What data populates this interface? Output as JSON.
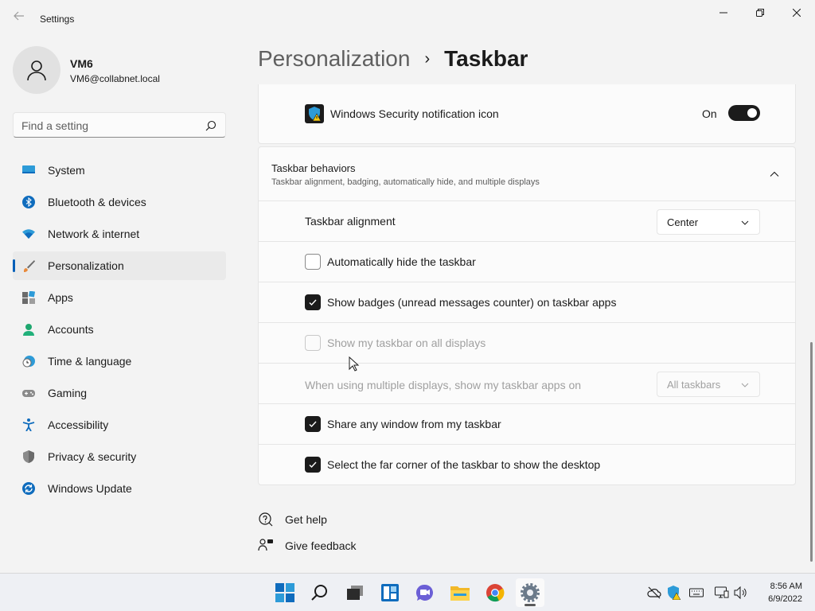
{
  "window": {
    "title": "Settings"
  },
  "profile": {
    "name": "VM6",
    "email": "VM6@collabnet.local"
  },
  "search": {
    "placeholder": "Find a setting"
  },
  "nav": {
    "items": [
      {
        "label": "System",
        "icon": "monitor-icon"
      },
      {
        "label": "Bluetooth & devices",
        "icon": "bluetooth-icon"
      },
      {
        "label": "Network & internet",
        "icon": "wifi-icon"
      },
      {
        "label": "Personalization",
        "icon": "brush-icon",
        "active": true
      },
      {
        "label": "Apps",
        "icon": "apps-icon"
      },
      {
        "label": "Accounts",
        "icon": "person-icon"
      },
      {
        "label": "Time & language",
        "icon": "clock-globe-icon"
      },
      {
        "label": "Gaming",
        "icon": "controller-icon"
      },
      {
        "label": "Accessibility",
        "icon": "accessibility-icon"
      },
      {
        "label": "Privacy & security",
        "icon": "shield-icon"
      },
      {
        "label": "Windows Update",
        "icon": "update-icon"
      }
    ]
  },
  "breadcrumb": {
    "parent": "Personalization",
    "separator": "›",
    "current": "Taskbar"
  },
  "security_row": {
    "label": "Windows Security notification icon",
    "state": "On"
  },
  "behaviors": {
    "title": "Taskbar behaviors",
    "subtitle": "Taskbar alignment, badging, automatically hide, and multiple displays",
    "alignment": {
      "label": "Taskbar alignment",
      "value": "Center"
    },
    "auto_hide": {
      "label": "Automatically hide the taskbar",
      "checked": false
    },
    "badges": {
      "label": "Show badges (unread messages counter) on taskbar apps",
      "checked": true
    },
    "all_displays": {
      "label": "Show my taskbar on all displays",
      "checked": false,
      "disabled": true
    },
    "multi_display": {
      "label": "When using multiple displays, show my taskbar apps on",
      "value": "All taskbars",
      "disabled": true
    },
    "share_window": {
      "label": "Share any window from my taskbar",
      "checked": true
    },
    "far_corner": {
      "label": "Select the far corner of the taskbar to show the desktop",
      "checked": true
    }
  },
  "help": {
    "get_help": "Get help",
    "give_feedback": "Give feedback"
  },
  "taskbar": {
    "apps": [
      "start-icon",
      "search-icon",
      "task-view-icon",
      "widgets-icon",
      "chat-icon",
      "file-explorer-icon",
      "chrome-icon",
      "settings-icon"
    ],
    "clock_time": "8:56 AM",
    "clock_date": "6/9/2022"
  },
  "colors": {
    "accent": "#005fb8",
    "toggle_on": "#1b1b1b",
    "background": "#f3f3f3",
    "card": "#fbfbfb"
  }
}
